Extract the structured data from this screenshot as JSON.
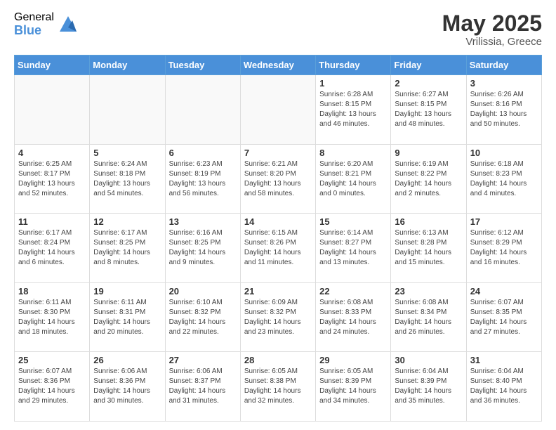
{
  "header": {
    "logo_general": "General",
    "logo_blue": "Blue",
    "title": "May 2025",
    "subtitle": "Vrilissia, Greece"
  },
  "days_of_week": [
    "Sunday",
    "Monday",
    "Tuesday",
    "Wednesday",
    "Thursday",
    "Friday",
    "Saturday"
  ],
  "weeks": [
    [
      {
        "day": "",
        "empty": true
      },
      {
        "day": "",
        "empty": true
      },
      {
        "day": "",
        "empty": true
      },
      {
        "day": "",
        "empty": true
      },
      {
        "day": "1",
        "sunrise": "6:28 AM",
        "sunset": "8:15 PM",
        "daylight": "13 hours and 46 minutes."
      },
      {
        "day": "2",
        "sunrise": "6:27 AM",
        "sunset": "8:15 PM",
        "daylight": "13 hours and 48 minutes."
      },
      {
        "day": "3",
        "sunrise": "6:26 AM",
        "sunset": "8:16 PM",
        "daylight": "13 hours and 50 minutes."
      }
    ],
    [
      {
        "day": "4",
        "sunrise": "6:25 AM",
        "sunset": "8:17 PM",
        "daylight": "13 hours and 52 minutes."
      },
      {
        "day": "5",
        "sunrise": "6:24 AM",
        "sunset": "8:18 PM",
        "daylight": "13 hours and 54 minutes."
      },
      {
        "day": "6",
        "sunrise": "6:23 AM",
        "sunset": "8:19 PM",
        "daylight": "13 hours and 56 minutes."
      },
      {
        "day": "7",
        "sunrise": "6:21 AM",
        "sunset": "8:20 PM",
        "daylight": "13 hours and 58 minutes."
      },
      {
        "day": "8",
        "sunrise": "6:20 AM",
        "sunset": "8:21 PM",
        "daylight": "14 hours and 0 minutes."
      },
      {
        "day": "9",
        "sunrise": "6:19 AM",
        "sunset": "8:22 PM",
        "daylight": "14 hours and 2 minutes."
      },
      {
        "day": "10",
        "sunrise": "6:18 AM",
        "sunset": "8:23 PM",
        "daylight": "14 hours and 4 minutes."
      }
    ],
    [
      {
        "day": "11",
        "sunrise": "6:17 AM",
        "sunset": "8:24 PM",
        "daylight": "14 hours and 6 minutes."
      },
      {
        "day": "12",
        "sunrise": "6:17 AM",
        "sunset": "8:25 PM",
        "daylight": "14 hours and 8 minutes."
      },
      {
        "day": "13",
        "sunrise": "6:16 AM",
        "sunset": "8:25 PM",
        "daylight": "14 hours and 9 minutes."
      },
      {
        "day": "14",
        "sunrise": "6:15 AM",
        "sunset": "8:26 PM",
        "daylight": "14 hours and 11 minutes."
      },
      {
        "day": "15",
        "sunrise": "6:14 AM",
        "sunset": "8:27 PM",
        "daylight": "14 hours and 13 minutes."
      },
      {
        "day": "16",
        "sunrise": "6:13 AM",
        "sunset": "8:28 PM",
        "daylight": "14 hours and 15 minutes."
      },
      {
        "day": "17",
        "sunrise": "6:12 AM",
        "sunset": "8:29 PM",
        "daylight": "14 hours and 16 minutes."
      }
    ],
    [
      {
        "day": "18",
        "sunrise": "6:11 AM",
        "sunset": "8:30 PM",
        "daylight": "14 hours and 18 minutes."
      },
      {
        "day": "19",
        "sunrise": "6:11 AM",
        "sunset": "8:31 PM",
        "daylight": "14 hours and 20 minutes."
      },
      {
        "day": "20",
        "sunrise": "6:10 AM",
        "sunset": "8:32 PM",
        "daylight": "14 hours and 22 minutes."
      },
      {
        "day": "21",
        "sunrise": "6:09 AM",
        "sunset": "8:32 PM",
        "daylight": "14 hours and 23 minutes."
      },
      {
        "day": "22",
        "sunrise": "6:08 AM",
        "sunset": "8:33 PM",
        "daylight": "14 hours and 24 minutes."
      },
      {
        "day": "23",
        "sunrise": "6:08 AM",
        "sunset": "8:34 PM",
        "daylight": "14 hours and 26 minutes."
      },
      {
        "day": "24",
        "sunrise": "6:07 AM",
        "sunset": "8:35 PM",
        "daylight": "14 hours and 27 minutes."
      }
    ],
    [
      {
        "day": "25",
        "sunrise": "6:07 AM",
        "sunset": "8:36 PM",
        "daylight": "14 hours and 29 minutes."
      },
      {
        "day": "26",
        "sunrise": "6:06 AM",
        "sunset": "8:36 PM",
        "daylight": "14 hours and 30 minutes."
      },
      {
        "day": "27",
        "sunrise": "6:06 AM",
        "sunset": "8:37 PM",
        "daylight": "14 hours and 31 minutes."
      },
      {
        "day": "28",
        "sunrise": "6:05 AM",
        "sunset": "8:38 PM",
        "daylight": "14 hours and 32 minutes."
      },
      {
        "day": "29",
        "sunrise": "6:05 AM",
        "sunset": "8:39 PM",
        "daylight": "14 hours and 34 minutes."
      },
      {
        "day": "30",
        "sunrise": "6:04 AM",
        "sunset": "8:39 PM",
        "daylight": "14 hours and 35 minutes."
      },
      {
        "day": "31",
        "sunrise": "6:04 AM",
        "sunset": "8:40 PM",
        "daylight": "14 hours and 36 minutes."
      }
    ]
  ],
  "labels": {
    "sunrise": "Sunrise:",
    "sunset": "Sunset:",
    "daylight": "Daylight:"
  }
}
